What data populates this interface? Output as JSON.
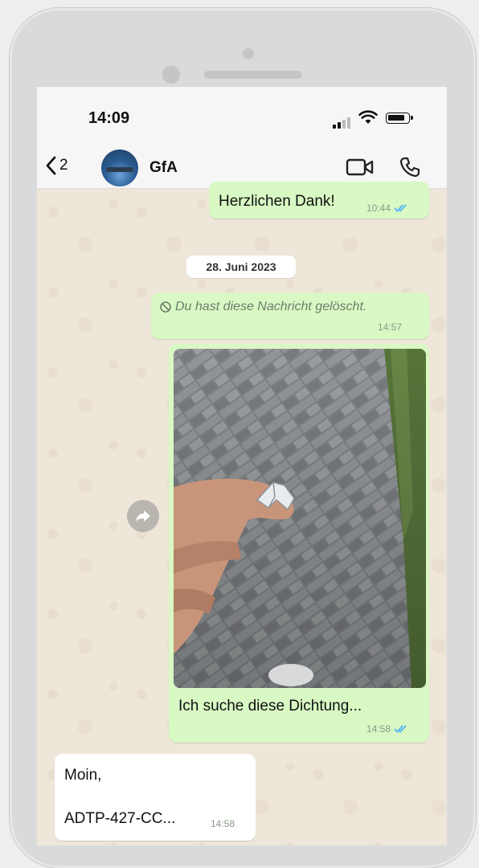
{
  "status_bar": {
    "time": "14:09"
  },
  "header": {
    "back_count": "2",
    "contact_name": "GfA"
  },
  "messages": {
    "thanks": {
      "text": "Herzlichen Dank!",
      "time": "10:44"
    },
    "date_separator": "28. Juni 2023",
    "deleted": {
      "text": "Du hast diese Nachricht gelöscht.",
      "time": "14:57"
    },
    "photo_message": {
      "caption": "Ich suche diese Dichtung...",
      "time": "14:58"
    },
    "incoming": {
      "greeting": "Moin,",
      "preview": "ADTP-427-CC...",
      "time": "14:58"
    }
  },
  "colors": {
    "outgoing_bubble": "#d8f8c4",
    "incoming_bubble": "#ffffff",
    "read_ticks": "#4fb3f6",
    "chat_background": "#efe6da"
  },
  "icons": [
    "back-chevron-icon",
    "video-call-icon",
    "phone-call-icon",
    "forward-icon",
    "deleted-icon",
    "read-ticks-icon"
  ]
}
